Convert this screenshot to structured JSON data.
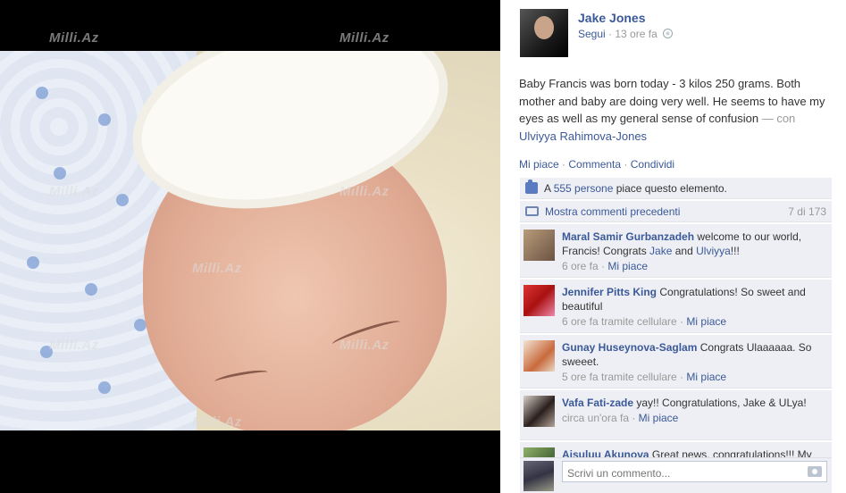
{
  "watermark": "Milli.Az",
  "author": {
    "name": "Jake Jones",
    "follow_label": "Segui",
    "separator": " · ",
    "time": "13 ore fa"
  },
  "post": {
    "text": "Baby Francis was born today - 3 kilos 250 grams. Both mother and baby are doing very well. He seems to have my eyes as well as my general sense of confusion",
    "with_label": " — con ",
    "tagged": "Ulviyya Rahimova-Jones"
  },
  "actions": {
    "like": "Mi piace",
    "comment": "Commenta",
    "share": "Condividi",
    "separator": " · "
  },
  "likes": {
    "prefix": "A ",
    "count_link": "555 persone",
    "suffix": " piace questo elemento."
  },
  "previous_comments": {
    "label": "Mostra commenti precedenti",
    "count": "7 di 173"
  },
  "comments": [
    {
      "name": "Maral Samir Gurbanzadeh",
      "text_a": " welcome to our world, Francis! Congrats ",
      "link_a": "Jake",
      "text_b": " and ",
      "link_b": "Ulviyya",
      "text_c": "!!!",
      "meta": "6 ore fa",
      "like": "Mi piace"
    },
    {
      "name": "Jennifer Pitts King",
      "text": " Congratulations! So sweet and beautiful",
      "meta": "6 ore fa tramite cellulare",
      "like": "Mi piace"
    },
    {
      "name": "Gunay Huseynova-Saglam",
      "text": " Congrats Ulaaaaaa. So sweeet.",
      "meta": "5 ore fa tramite cellulare",
      "like": "Mi piace"
    },
    {
      "name": "Vafa Fati-zade",
      "text": " yay!! Congratulations, Jake & ULya!",
      "meta": "circa un'ora fa",
      "like": "Mi piace"
    },
    {
      "name": "Aisuluu Akunova",
      "text": " Great news, congratulations!!! My best wishes to all of you!"
    }
  ],
  "compose": {
    "placeholder": "Scrivi un commento..."
  },
  "colors": {
    "link": "#3b5998",
    "muted": "#999999",
    "ufi_bg": "#edeff4"
  }
}
